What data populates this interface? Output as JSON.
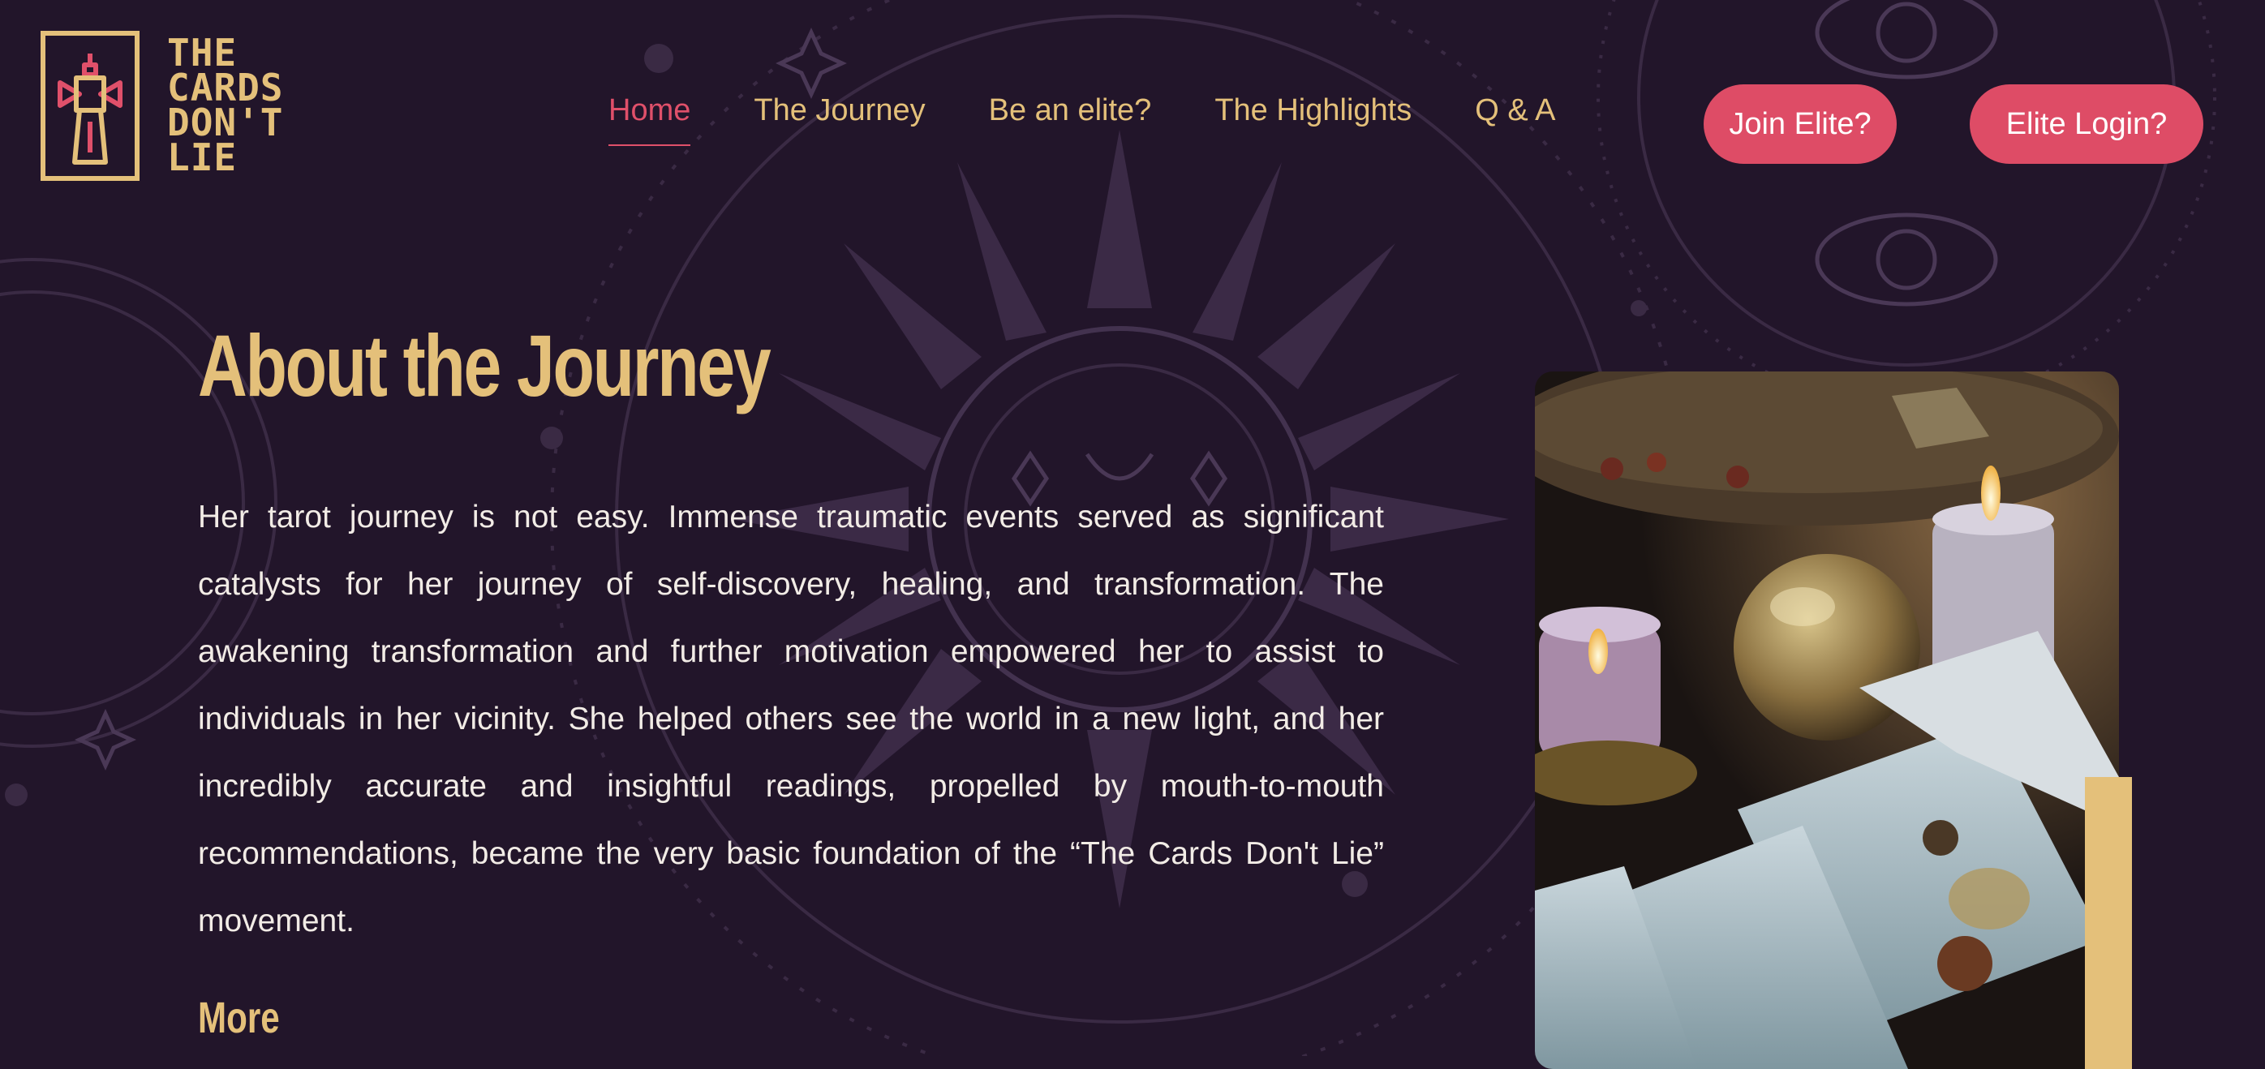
{
  "logo": {
    "words": [
      "THE",
      "CARDS",
      "DON'T",
      "LIE"
    ]
  },
  "nav": {
    "items": [
      {
        "label": "Home",
        "active": true
      },
      {
        "label": "The Journey",
        "active": false
      },
      {
        "label": "Be an elite?",
        "active": false
      },
      {
        "label": "The Highlights",
        "active": false
      },
      {
        "label": "Q & A",
        "active": false
      }
    ],
    "join_label": "Join Elite?",
    "login_label": "Elite Login?"
  },
  "main": {
    "title": "About the Journey",
    "body": "Her tarot journey is not easy. Immense traumatic events served as significant catalysts for her journey of self-discovery, healing, and transformation. The awakening transformation and further motivation empowered her to assist to individuals in her vicinity. She helped others see the world in a new light, and her incredibly accurate and insightful readings, propelled by mouth-to-mouth recommendations, became the very basic foundation of the “The Cards Don't Lie” movement.",
    "more_label": "More"
  },
  "colors": {
    "background": "#22152a",
    "gold": "#e4c07a",
    "accent": "#de4c66",
    "text": "#f2ece6"
  },
  "icons": {
    "logo": "tower-logo-icon"
  }
}
